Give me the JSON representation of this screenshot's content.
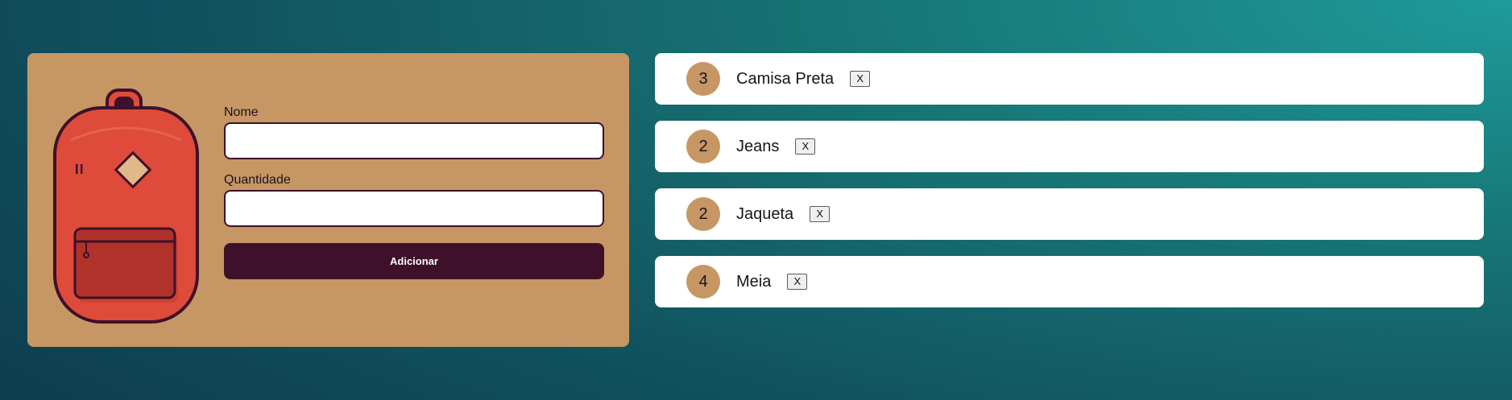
{
  "form": {
    "name_label": "Nome",
    "name_value": "",
    "quantity_label": "Quantidade",
    "quantity_value": "",
    "submit_label": "Adicionar"
  },
  "items": [
    {
      "quantity": "3",
      "name": "Camisa Preta",
      "remove_label": "X"
    },
    {
      "quantity": "2",
      "name": "Jeans",
      "remove_label": "X"
    },
    {
      "quantity": "2",
      "name": "Jaqueta",
      "remove_label": "X"
    },
    {
      "quantity": "4",
      "name": "Meia",
      "remove_label": "X"
    }
  ],
  "icons": {
    "illustration": "backpack-icon",
    "remove": "close-icon"
  },
  "colors": {
    "panel": "#c69764",
    "accent": "#3e1029",
    "backpack_body": "#de4b3a",
    "backpack_pocket": "#b0322b",
    "badge": "#c69764",
    "card": "#ffffff"
  }
}
